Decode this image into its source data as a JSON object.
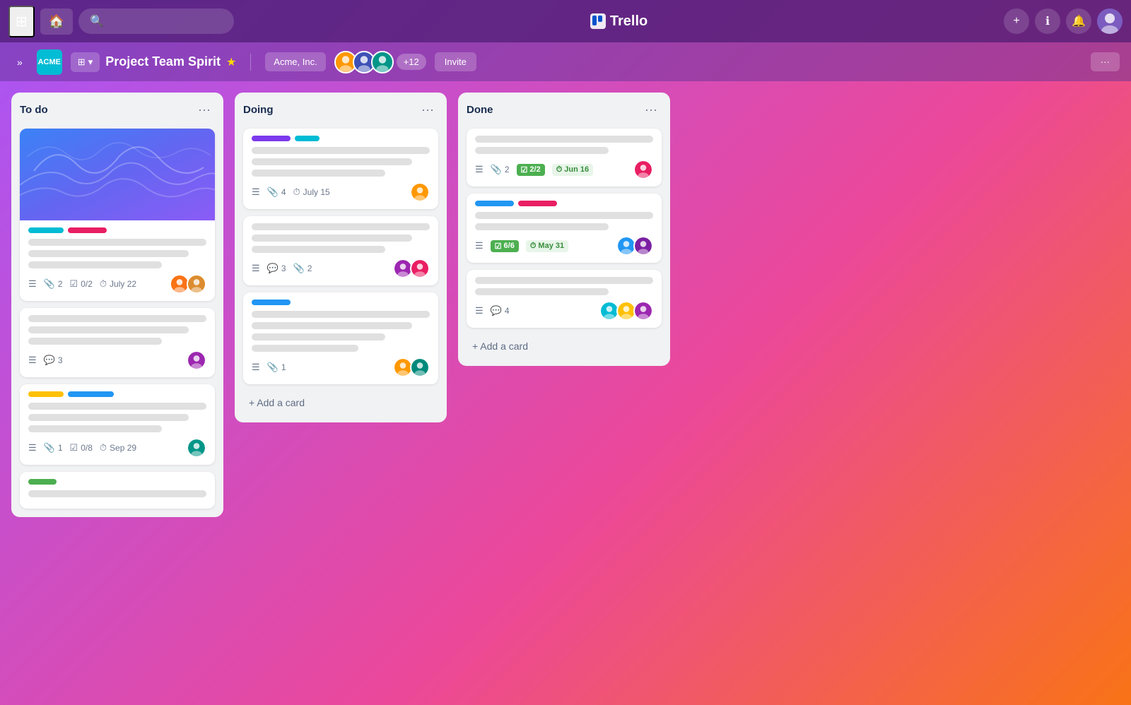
{
  "app": {
    "name": "Trello",
    "logo_text": "⬛ Trello"
  },
  "nav": {
    "home_label": "🏠",
    "search_placeholder": "🔍",
    "add_label": "+",
    "info_label": "ℹ",
    "bell_label": "🔔",
    "more_label": "···"
  },
  "board": {
    "workspace_icon": "ACME",
    "view_icon": "⊞",
    "title": "Project Team Spirit",
    "star": "★",
    "workspace_tag": "Acme, Inc.",
    "member_count_label": "+12",
    "invite_label": "Invite",
    "more_label": "···",
    "expand_label": "»"
  },
  "columns": [
    {
      "id": "todo",
      "title": "To do",
      "cards": [
        {
          "id": "card1",
          "has_cover": true,
          "labels": [
            "cyan",
            "pink"
          ],
          "lines": [
            "full",
            "long",
            "medium"
          ],
          "meta": {
            "description": true,
            "attachments": "2",
            "checklist": "0/2",
            "date": "July 22"
          },
          "avatars": [
            "orange",
            "yellow"
          ]
        },
        {
          "id": "card2",
          "has_cover": false,
          "labels": [],
          "lines": [
            "full",
            "long",
            "medium"
          ],
          "meta": {
            "description": true,
            "comments": "3"
          },
          "avatars": [
            "purple"
          ]
        },
        {
          "id": "card3",
          "has_cover": false,
          "labels": [
            "yellow",
            "blue2"
          ],
          "lines": [
            "full",
            "long",
            "medium"
          ],
          "meta": {
            "description": true,
            "attachments": "1",
            "checklist": "0/8",
            "date": "Sep 29"
          },
          "avatars": [
            "teal"
          ]
        },
        {
          "id": "card4",
          "has_cover": false,
          "labels": [
            "green"
          ],
          "lines": [
            "full"
          ],
          "meta": {},
          "avatars": []
        }
      ]
    },
    {
      "id": "doing",
      "title": "Doing",
      "cards": [
        {
          "id": "card5",
          "has_cover": false,
          "labels": [
            "purple",
            "teal"
          ],
          "lines": [
            "full",
            "long",
            "medium"
          ],
          "meta": {
            "description": true,
            "attachments": "4",
            "date": "July 15"
          },
          "avatars": [
            "orange"
          ]
        },
        {
          "id": "card6",
          "has_cover": false,
          "labels": [],
          "lines": [
            "full",
            "long",
            "medium"
          ],
          "meta": {
            "description": true,
            "comments": "3",
            "attachments": "2"
          },
          "avatars": [
            "purple",
            "pink"
          ]
        },
        {
          "id": "card7",
          "has_cover": false,
          "labels": [
            "blue"
          ],
          "lines": [
            "full",
            "long",
            "medium",
            "short"
          ],
          "meta": {
            "description": true,
            "attachments": "1"
          },
          "avatars": [
            "yellow",
            "teal"
          ]
        }
      ]
    },
    {
      "id": "done",
      "title": "Done",
      "cards": [
        {
          "id": "card8",
          "has_cover": false,
          "labels": [],
          "lines": [
            "full",
            "medium"
          ],
          "meta": {
            "description": true,
            "attachments": "2",
            "checklist_done": "2/2",
            "date_done": "Jun 16"
          },
          "avatars": [
            "pink"
          ]
        },
        {
          "id": "card9",
          "has_cover": false,
          "labels": [
            "blue",
            "pink"
          ],
          "lines": [
            "full",
            "medium"
          ],
          "meta": {
            "description": true,
            "checklist_done": "6/6",
            "date_done": "May 31"
          },
          "avatars": [
            "blue",
            "purple"
          ]
        },
        {
          "id": "card10",
          "has_cover": false,
          "labels": [],
          "lines": [
            "full",
            "medium"
          ],
          "meta": {
            "description": true,
            "comments": "4"
          },
          "avatars": [
            "teal",
            "yellow",
            "purple"
          ]
        }
      ]
    }
  ],
  "add_card_label": "+ Add a card"
}
